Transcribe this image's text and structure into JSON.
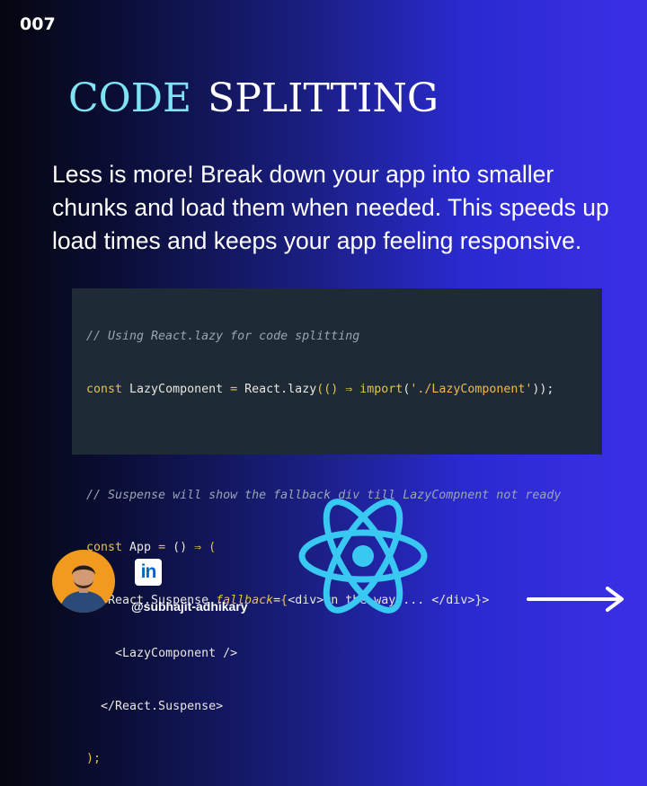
{
  "page_number": "007",
  "title": {
    "accent": "CODE",
    "plain": "SPLITTING"
  },
  "description": [
    "Less is more! Break down your app into smaller",
    "chunks and load them when needed. This speeds up",
    "load times and keeps your app feeling responsive."
  ],
  "code": {
    "comment1": "// Using React.lazy for code splitting",
    "l2_kw": "const",
    "l2_id": " LazyComponent ",
    "l2_eq": "=",
    "l2_fn": " React.lazy",
    "l2_p1": "(",
    "l2_args": "()",
    "l2_arrow": " ⇒ ",
    "l2_import": "import",
    "l2_p2": "(",
    "l2_str": "'./LazyComponent'",
    "l2_end": "));",
    "comment2": "// Suspense will show the fallback div till LazyCompnent not ready",
    "l5_kw": "const",
    "l5_id": " App ",
    "l5_eq": "=",
    "l5_args": " () ",
    "l5_arrow": "⇒",
    "l5_open": " (",
    "l6_indent": "  ",
    "l6_tag": "<React.Suspense ",
    "l6_attr": "fallback",
    "l6_eq": "=",
    "l6_brace": "{",
    "l6_div": "<div>On the way ... </div>",
    "l6_close": "}>",
    "l7_indent": "    ",
    "l7_tag": "<LazyComponent />",
    "l8_indent": "  ",
    "l8_tag": "</React.Suspense>",
    "l9": ");"
  },
  "author": {
    "linkedin_label": "in",
    "handle": "@subhajit-adhikary"
  },
  "icons": {
    "logo": "react-logo-icon",
    "next": "arrow-right-icon",
    "linkedin": "linkedin-icon"
  },
  "colors": {
    "title_accent": "#7fe3f5",
    "react_blue": "#38c8f2",
    "code_bg": "#1e2b36",
    "avatar_bg": "#f29a1e"
  }
}
